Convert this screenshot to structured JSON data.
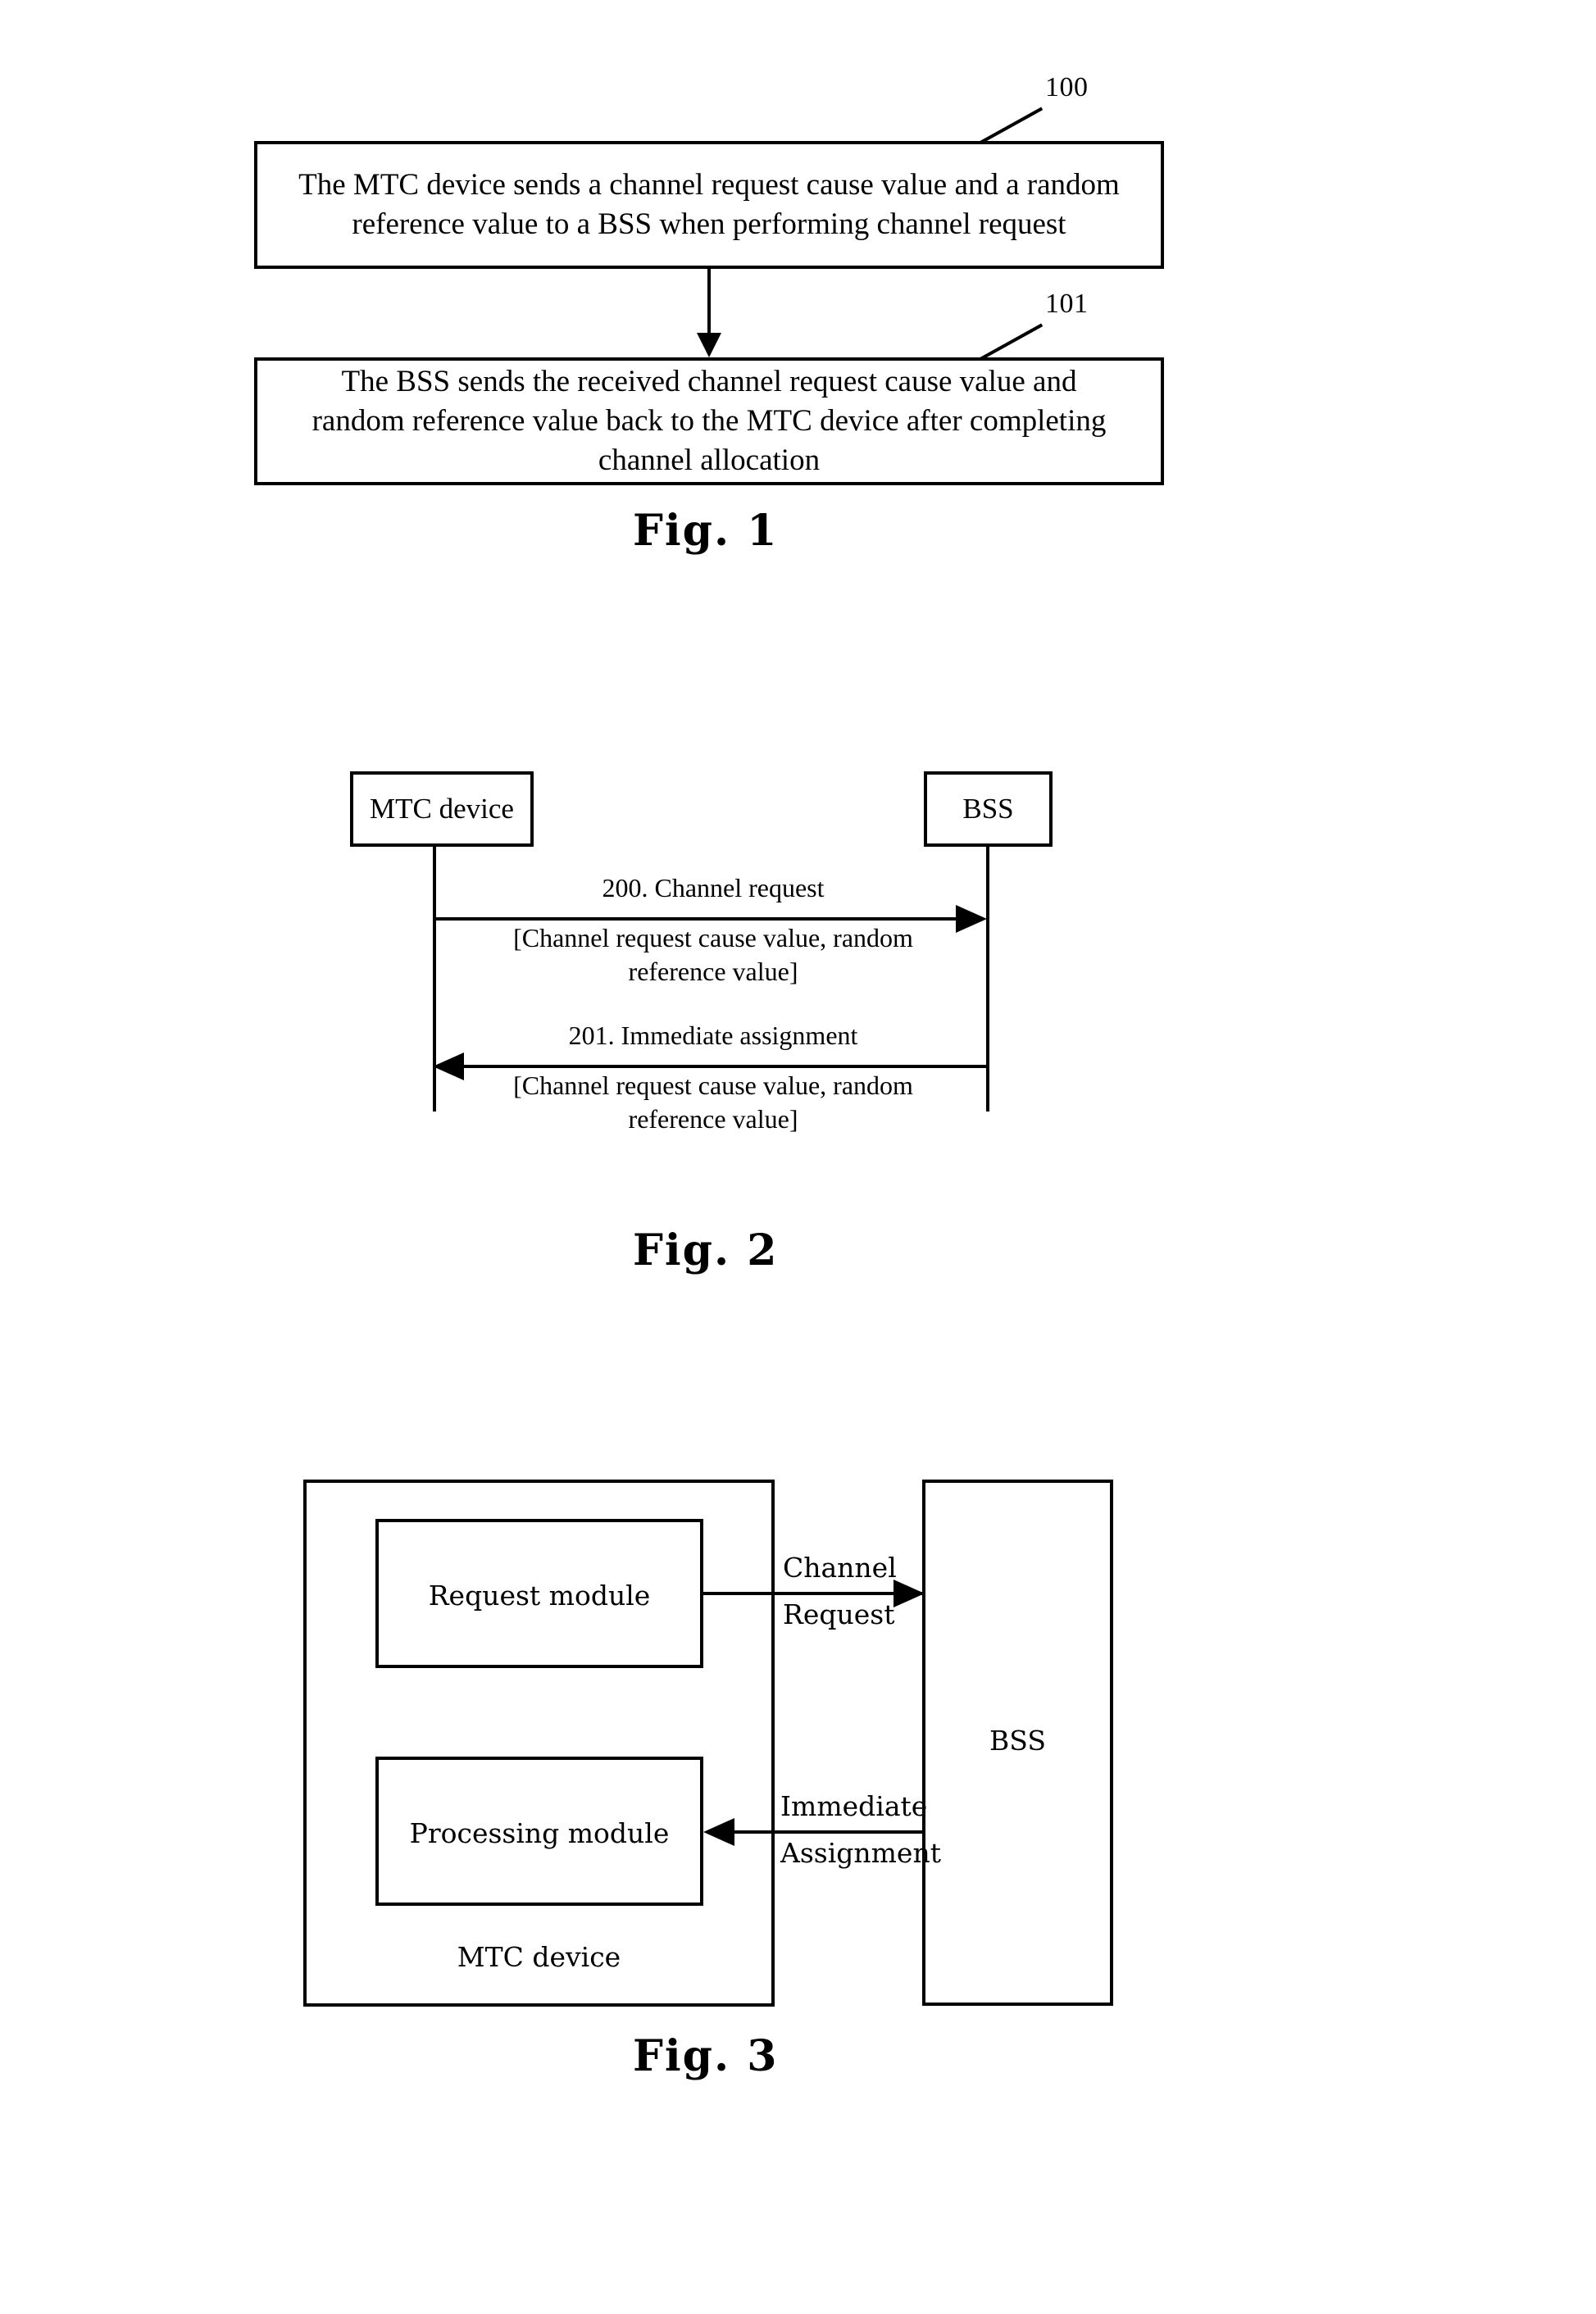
{
  "figure1": {
    "caption": "Fig. 1",
    "steps": [
      {
        "ref": "100",
        "text": "The MTC device sends a channel request cause value and a random\nreference value to a BSS when performing channel request"
      },
      {
        "ref": "101",
        "text": "The BSS sends the received channel request cause value and\nrandom reference value back to the MTC device after completing\nchannel allocation"
      }
    ]
  },
  "figure2": {
    "caption": "Fig. 2",
    "nodes": {
      "left": "MTC device",
      "right": "BSS"
    },
    "messages": [
      {
        "direction": "right",
        "title": "200. Channel request",
        "params": "[Channel request cause value, random\nreference value]"
      },
      {
        "direction": "left",
        "title": "201. Immediate assignment",
        "params": "[Channel request cause value, random\nreference value]"
      }
    ]
  },
  "figure3": {
    "caption": "Fig. 3",
    "device": {
      "label": "MTC device",
      "modules": [
        "Request module",
        "Processing module"
      ]
    },
    "network": {
      "label": "BSS"
    },
    "connections": [
      {
        "direction": "right",
        "line1": "Channel",
        "line2": "Request"
      },
      {
        "direction": "left",
        "line1": "Immediate",
        "line2": "Assignment"
      }
    ]
  },
  "colors": {
    "ink": "#000000",
    "paper": "#ffffff"
  }
}
